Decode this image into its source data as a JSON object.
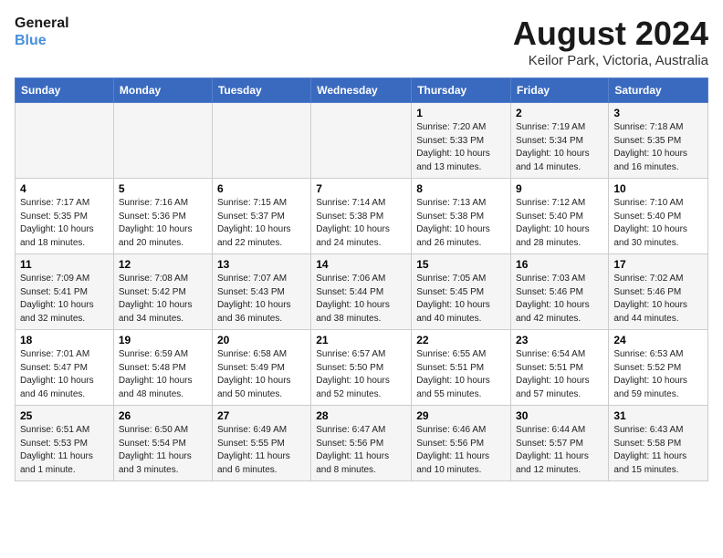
{
  "logo": {
    "line1": "General",
    "line2": "Blue"
  },
  "title": "August 2024",
  "location": "Keilor Park, Victoria, Australia",
  "days_of_week": [
    "Sunday",
    "Monday",
    "Tuesday",
    "Wednesday",
    "Thursday",
    "Friday",
    "Saturday"
  ],
  "weeks": [
    [
      {
        "day": "",
        "info": ""
      },
      {
        "day": "",
        "info": ""
      },
      {
        "day": "",
        "info": ""
      },
      {
        "day": "",
        "info": ""
      },
      {
        "day": "1",
        "info": "Sunrise: 7:20 AM\nSunset: 5:33 PM\nDaylight: 10 hours\nand 13 minutes."
      },
      {
        "day": "2",
        "info": "Sunrise: 7:19 AM\nSunset: 5:34 PM\nDaylight: 10 hours\nand 14 minutes."
      },
      {
        "day": "3",
        "info": "Sunrise: 7:18 AM\nSunset: 5:35 PM\nDaylight: 10 hours\nand 16 minutes."
      }
    ],
    [
      {
        "day": "4",
        "info": "Sunrise: 7:17 AM\nSunset: 5:35 PM\nDaylight: 10 hours\nand 18 minutes."
      },
      {
        "day": "5",
        "info": "Sunrise: 7:16 AM\nSunset: 5:36 PM\nDaylight: 10 hours\nand 20 minutes."
      },
      {
        "day": "6",
        "info": "Sunrise: 7:15 AM\nSunset: 5:37 PM\nDaylight: 10 hours\nand 22 minutes."
      },
      {
        "day": "7",
        "info": "Sunrise: 7:14 AM\nSunset: 5:38 PM\nDaylight: 10 hours\nand 24 minutes."
      },
      {
        "day": "8",
        "info": "Sunrise: 7:13 AM\nSunset: 5:38 PM\nDaylight: 10 hours\nand 26 minutes."
      },
      {
        "day": "9",
        "info": "Sunrise: 7:12 AM\nSunset: 5:40 PM\nDaylight: 10 hours\nand 28 minutes."
      },
      {
        "day": "10",
        "info": "Sunrise: 7:10 AM\nSunset: 5:40 PM\nDaylight: 10 hours\nand 30 minutes."
      }
    ],
    [
      {
        "day": "11",
        "info": "Sunrise: 7:09 AM\nSunset: 5:41 PM\nDaylight: 10 hours\nand 32 minutes."
      },
      {
        "day": "12",
        "info": "Sunrise: 7:08 AM\nSunset: 5:42 PM\nDaylight: 10 hours\nand 34 minutes."
      },
      {
        "day": "13",
        "info": "Sunrise: 7:07 AM\nSunset: 5:43 PM\nDaylight: 10 hours\nand 36 minutes."
      },
      {
        "day": "14",
        "info": "Sunrise: 7:06 AM\nSunset: 5:44 PM\nDaylight: 10 hours\nand 38 minutes."
      },
      {
        "day": "15",
        "info": "Sunrise: 7:05 AM\nSunset: 5:45 PM\nDaylight: 10 hours\nand 40 minutes."
      },
      {
        "day": "16",
        "info": "Sunrise: 7:03 AM\nSunset: 5:46 PM\nDaylight: 10 hours\nand 42 minutes."
      },
      {
        "day": "17",
        "info": "Sunrise: 7:02 AM\nSunset: 5:46 PM\nDaylight: 10 hours\nand 44 minutes."
      }
    ],
    [
      {
        "day": "18",
        "info": "Sunrise: 7:01 AM\nSunset: 5:47 PM\nDaylight: 10 hours\nand 46 minutes."
      },
      {
        "day": "19",
        "info": "Sunrise: 6:59 AM\nSunset: 5:48 PM\nDaylight: 10 hours\nand 48 minutes."
      },
      {
        "day": "20",
        "info": "Sunrise: 6:58 AM\nSunset: 5:49 PM\nDaylight: 10 hours\nand 50 minutes."
      },
      {
        "day": "21",
        "info": "Sunrise: 6:57 AM\nSunset: 5:50 PM\nDaylight: 10 hours\nand 52 minutes."
      },
      {
        "day": "22",
        "info": "Sunrise: 6:55 AM\nSunset: 5:51 PM\nDaylight: 10 hours\nand 55 minutes."
      },
      {
        "day": "23",
        "info": "Sunrise: 6:54 AM\nSunset: 5:51 PM\nDaylight: 10 hours\nand 57 minutes."
      },
      {
        "day": "24",
        "info": "Sunrise: 6:53 AM\nSunset: 5:52 PM\nDaylight: 10 hours\nand 59 minutes."
      }
    ],
    [
      {
        "day": "25",
        "info": "Sunrise: 6:51 AM\nSunset: 5:53 PM\nDaylight: 11 hours\nand 1 minute."
      },
      {
        "day": "26",
        "info": "Sunrise: 6:50 AM\nSunset: 5:54 PM\nDaylight: 11 hours\nand 3 minutes."
      },
      {
        "day": "27",
        "info": "Sunrise: 6:49 AM\nSunset: 5:55 PM\nDaylight: 11 hours\nand 6 minutes."
      },
      {
        "day": "28",
        "info": "Sunrise: 6:47 AM\nSunset: 5:56 PM\nDaylight: 11 hours\nand 8 minutes."
      },
      {
        "day": "29",
        "info": "Sunrise: 6:46 AM\nSunset: 5:56 PM\nDaylight: 11 hours\nand 10 minutes."
      },
      {
        "day": "30",
        "info": "Sunrise: 6:44 AM\nSunset: 5:57 PM\nDaylight: 11 hours\nand 12 minutes."
      },
      {
        "day": "31",
        "info": "Sunrise: 6:43 AM\nSunset: 5:58 PM\nDaylight: 11 hours\nand 15 minutes."
      }
    ]
  ]
}
